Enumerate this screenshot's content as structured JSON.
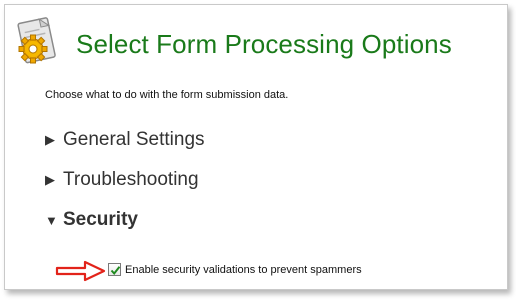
{
  "header": {
    "title": "Select Form Processing Options",
    "icon": "gear-document-icon"
  },
  "intro": "Choose what to do with the form submission data.",
  "sections": [
    {
      "label": "General Settings",
      "expanded": false
    },
    {
      "label": "Troubleshooting",
      "expanded": false
    },
    {
      "label": "Security",
      "expanded": true
    }
  ],
  "security": {
    "checkbox_label": "Enable security validations to prevent spammers",
    "checked": true
  },
  "colors": {
    "title": "#1a7a1a",
    "arrow": "#e2231a",
    "gear": "#f0a800"
  }
}
